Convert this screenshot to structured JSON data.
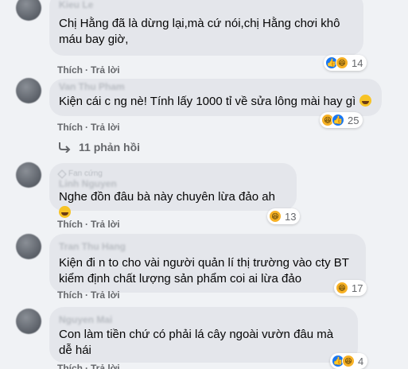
{
  "comments": [
    {
      "author": "Kieu Le",
      "text": "Chị Hằng đã là dừng lại,mà cứ nói,chị Hằng chơi khô máu bay giờ,",
      "emoji_suffix": "",
      "actions": {
        "like": "Thích",
        "reply": "Trả lời"
      },
      "reaction_icons": [
        "like-icon",
        "haha-icon"
      ],
      "reaction_count": "14"
    },
    {
      "author": "Van Thu Pham",
      "text": "Kiện cái c ng nè! Tính lấy 1000 tỉ về sửa lông mài hay gì",
      "emoji_suffix": "grinning-sweat-emoji",
      "actions": {
        "like": "Thích",
        "reply": "Trả lời"
      },
      "reaction_icons": [
        "haha-icon",
        "like-icon"
      ],
      "reaction_count": "25",
      "replies": "11 phản hồi"
    },
    {
      "badge": "Fan cứng",
      "author": "Linh Nguyen",
      "text": "Nghe đồn đâu bà này chuyên lừa đảo ah",
      "emoji_suffix": "grinning-sweat-emoji",
      "actions": {
        "like": "Thích",
        "reply": "Trả lời"
      },
      "reaction_icons": [
        "haha-icon"
      ],
      "reaction_count": "13"
    },
    {
      "author": "Tran Thu Hang",
      "text": "Kiện đi n to cho vài người quản lí thị trường vào cty BT kiểm định chất lượng sản phẩm coi ai lừa đảo",
      "emoji_suffix": "",
      "actions": {
        "like": "Thích",
        "reply": "Trả lời"
      },
      "reaction_icons": [
        "haha-icon"
      ],
      "reaction_count": "17"
    },
    {
      "author": "Nguyen Mai",
      "text": "Con làm tiền chứ có phải lá cây ngoài vườn đâu mà dễ hái",
      "emoji_suffix": "",
      "actions": {
        "like": "Thích",
        "reply": "Trả lời"
      },
      "reaction_icons": [
        "like-icon",
        "haha-icon"
      ],
      "reaction_count": "4"
    }
  ],
  "colors": {
    "bubble": "#e4e6eb",
    "background": "#f0f2f5",
    "meta_text": "#65676b",
    "like_blue": "#1877f2",
    "haha_yellow": "#f7b125"
  }
}
